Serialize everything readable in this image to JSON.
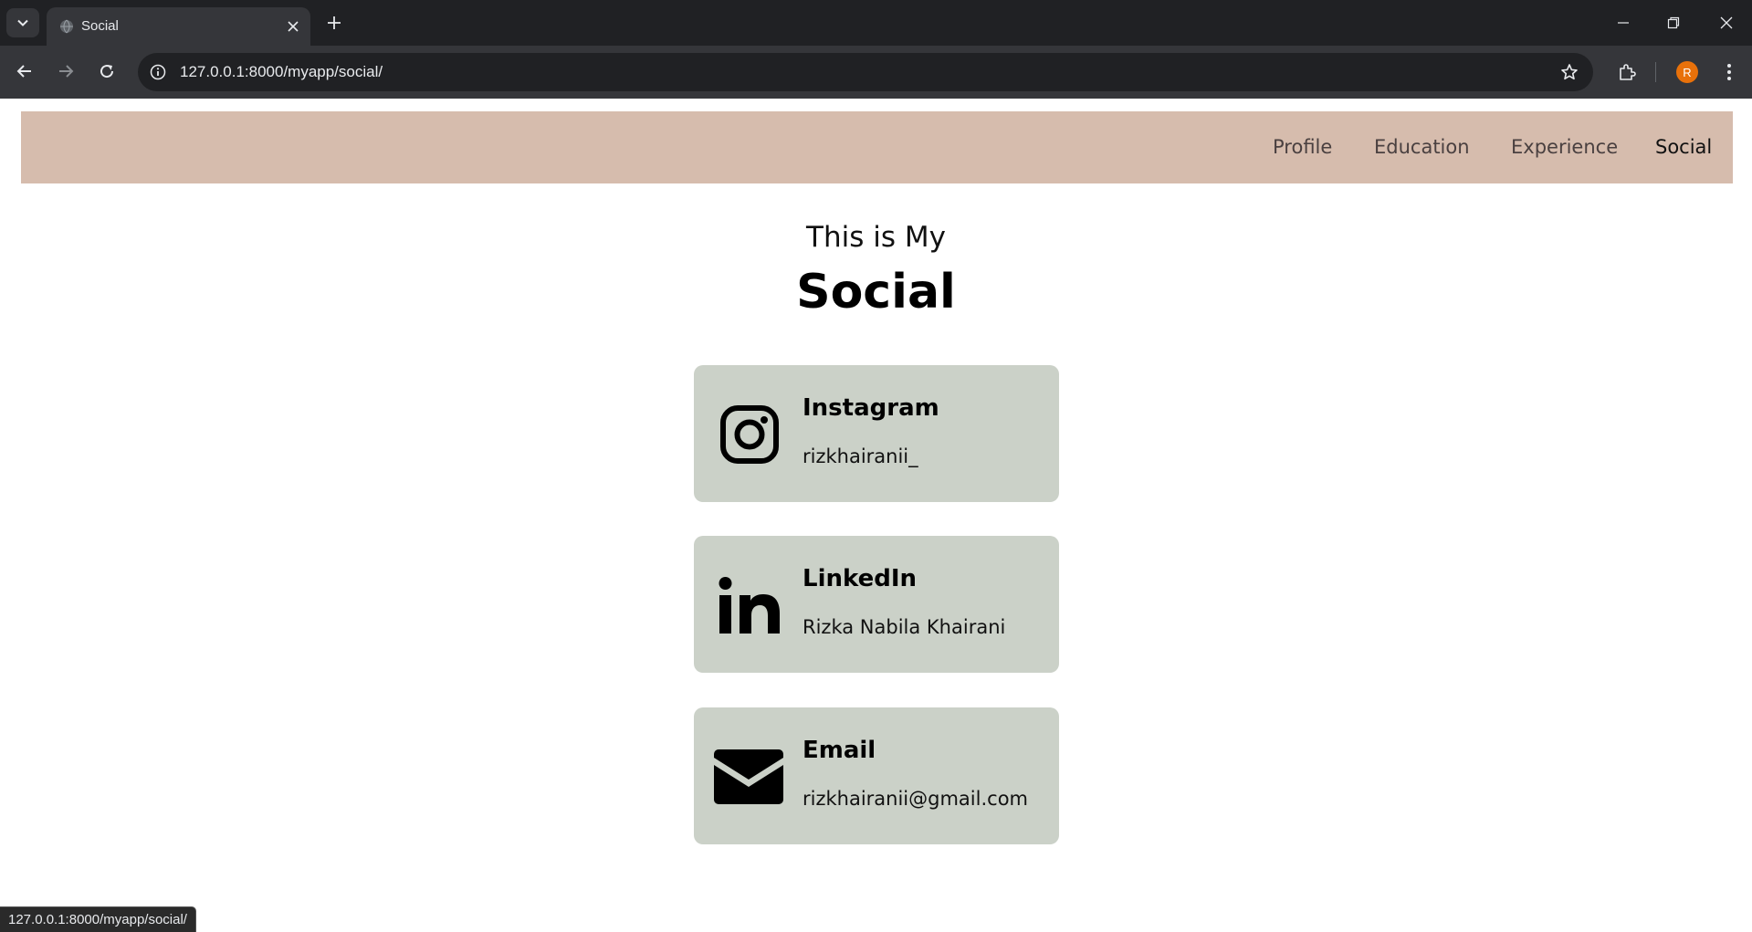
{
  "browser": {
    "tab_title": "Social",
    "url": "127.0.0.1:8000/myapp/social/",
    "profile_initial": "R",
    "status_url": "127.0.0.1:8000/myapp/social/"
  },
  "nav": {
    "items": [
      "Profile",
      "Education",
      "Experience",
      "Social"
    ],
    "active": "Social"
  },
  "header": {
    "subtitle": "This is My",
    "title": "Social"
  },
  "socials": [
    {
      "name": "Instagram",
      "value": "rizkhairanii_",
      "icon": "instagram-icon"
    },
    {
      "name": "LinkedIn",
      "value": "Rizka Nabila Khairani",
      "icon": "linkedin-icon"
    },
    {
      "name": "Email",
      "value": "rizkhairanii@gmail.com",
      "icon": "envelope-icon"
    }
  ],
  "colors": {
    "navbar": "#d6bcad",
    "card": "#cbd1c8"
  }
}
